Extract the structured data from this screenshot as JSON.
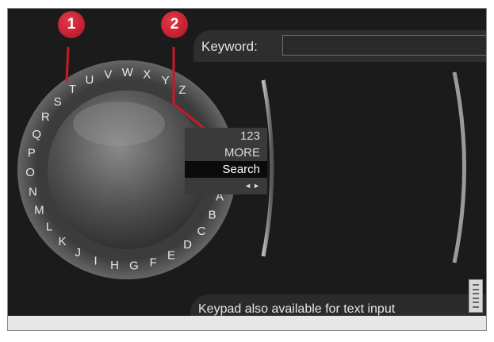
{
  "keyword": {
    "label": "Keyword:",
    "value": ""
  },
  "alphabet": [
    "Z",
    "Y",
    "X",
    "W",
    "V",
    "U",
    "T",
    "S",
    "R",
    "Q",
    "P",
    "O",
    "N",
    "M",
    "L",
    "K",
    "J",
    "I",
    "H",
    "G",
    "F",
    "E",
    "D",
    "C",
    "B",
    "A",
    "-"
  ],
  "menu": {
    "items": [
      {
        "label": "123",
        "selected": false
      },
      {
        "label": "MORE",
        "selected": false
      },
      {
        "label": "Search",
        "selected": true
      }
    ],
    "nav_left": "◄",
    "nav_right": "►"
  },
  "hint": "Keypad also available for text input",
  "callouts": [
    "1",
    "2"
  ],
  "icons": {
    "keypad": "keypad-icon"
  },
  "colors": {
    "screen_bg": "#1b1b1b",
    "callout": "#c8192a",
    "selected_bg": "#0b0b0b"
  }
}
